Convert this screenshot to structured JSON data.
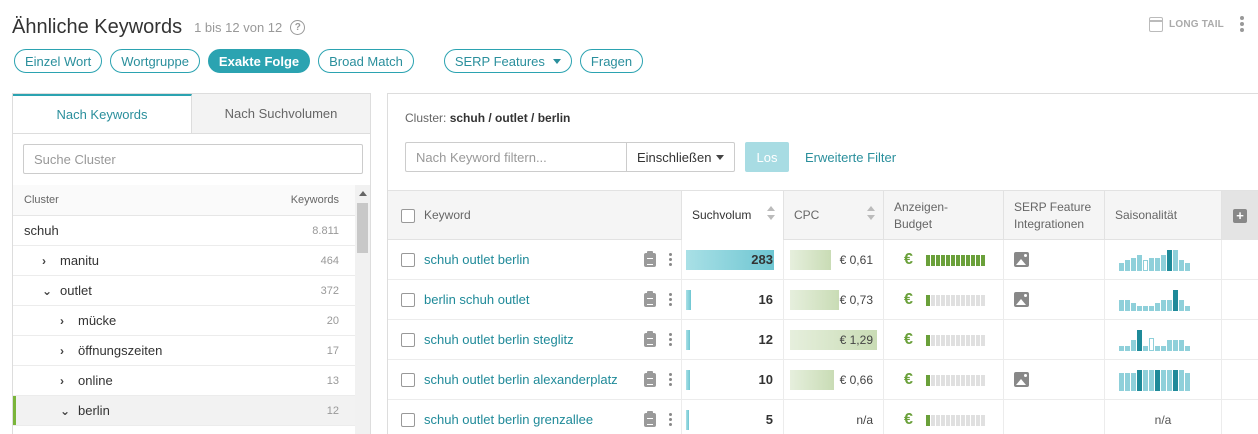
{
  "header": {
    "title": "Ähnliche Keywords",
    "count": "1 bis 12 von 12",
    "help_icon": "?",
    "long_tail": "LONG TAIL"
  },
  "pills": [
    {
      "label": "Einzel Wort",
      "active": false
    },
    {
      "label": "Wortgruppe",
      "active": false
    },
    {
      "label": "Exakte Folge",
      "active": true
    },
    {
      "label": "Broad Match",
      "active": false
    }
  ],
  "pills2": [
    {
      "label": "SERP Features",
      "dropdown": true
    },
    {
      "label": "Fragen",
      "dropdown": false
    }
  ],
  "left_panel": {
    "tabs": [
      "Nach Keywords",
      "Nach Suchvolumen"
    ],
    "search_placeholder": "Suche Cluster",
    "col_cluster": "Cluster",
    "col_keywords": "Keywords",
    "rows": [
      {
        "label": "schuh",
        "count": "8.811",
        "level": 0,
        "chev": "",
        "selected": false
      },
      {
        "label": "manitu",
        "count": "464",
        "level": 1,
        "chev": "›",
        "selected": false
      },
      {
        "label": "outlet",
        "count": "372",
        "level": 1,
        "chev": "⌄",
        "selected": false
      },
      {
        "label": "mücke",
        "count": "20",
        "level": 2,
        "chev": "›",
        "selected": false
      },
      {
        "label": "öffnungszeiten",
        "count": "17",
        "level": 2,
        "chev": "›",
        "selected": false
      },
      {
        "label": "online",
        "count": "13",
        "level": 2,
        "chev": "›",
        "selected": false
      },
      {
        "label": "berlin",
        "count": "12",
        "level": 2,
        "chev": "⌄",
        "selected": true
      }
    ]
  },
  "right_panel": {
    "cluster_label": "Cluster:",
    "cluster_path": "schuh / outlet / berlin",
    "filter_placeholder": "Nach Keyword filtern...",
    "include_select": "Einschließen",
    "go_button": "Los",
    "advanced_filter": "Erweiterte Filter",
    "columns": {
      "keyword": "Keyword",
      "volume": "Suchvolum",
      "cpc": "CPC",
      "budget_1": "Anzeigen-",
      "budget_2": "Budget",
      "serp_1": "SERP Feature",
      "serp_2": "Integrationen",
      "season": "Saisonalität"
    },
    "rows": [
      {
        "keyword": "schuh outlet berlin",
        "volume": "283",
        "volume_fraction": 1.0,
        "cpc": "€ 0,61",
        "cpc_fraction": 0.47,
        "budget_level": 12,
        "serp": true,
        "season": [
          3,
          4,
          5,
          6,
          4,
          5,
          5,
          6,
          8,
          8,
          4,
          3
        ],
        "season_dark": [
          8
        ],
        "season_hole": [
          4
        ]
      },
      {
        "keyword": "berlin schuh outlet",
        "volume": "16",
        "volume_fraction": 0.06,
        "cpc": "€ 0,73",
        "cpc_fraction": 0.56,
        "budget_level": 1,
        "serp": true,
        "season": [
          4,
          4,
          3,
          2,
          2,
          2,
          3,
          4,
          4,
          8,
          4,
          2
        ],
        "season_dark": [
          9
        ],
        "season_hole": []
      },
      {
        "keyword": "schuh outlet berlin steglitz",
        "volume": "12",
        "volume_fraction": 0.04,
        "cpc": "€ 1,29",
        "cpc_fraction": 1.0,
        "budget_level": 1,
        "serp": false,
        "season": [
          2,
          2,
          4,
          8,
          2,
          5,
          2,
          2,
          4,
          4,
          4,
          2
        ],
        "season_dark": [
          3
        ],
        "season_hole": [
          5
        ]
      },
      {
        "keyword": "schuh outlet berlin alexanderplatz",
        "volume": "10",
        "volume_fraction": 0.04,
        "cpc": "€ 0,66",
        "cpc_fraction": 0.51,
        "budget_level": 1,
        "serp": true,
        "season": [
          7,
          7,
          7,
          8,
          8,
          8,
          8,
          8,
          8,
          8,
          8,
          7
        ],
        "season_dark": [
          3,
          6,
          9
        ],
        "season_hole": []
      },
      {
        "keyword": "schuh outlet berlin grenzallee",
        "volume": "5",
        "volume_fraction": 0.02,
        "cpc": "n/a",
        "cpc_fraction": 0,
        "budget_level": 1,
        "serp": false,
        "season": [],
        "season_dark": [],
        "season_hole": [],
        "season_text": "n/a"
      }
    ]
  },
  "colors": {
    "accent": "#2ba3b1",
    "link": "#1f8a99",
    "green": "#6aa03a"
  }
}
